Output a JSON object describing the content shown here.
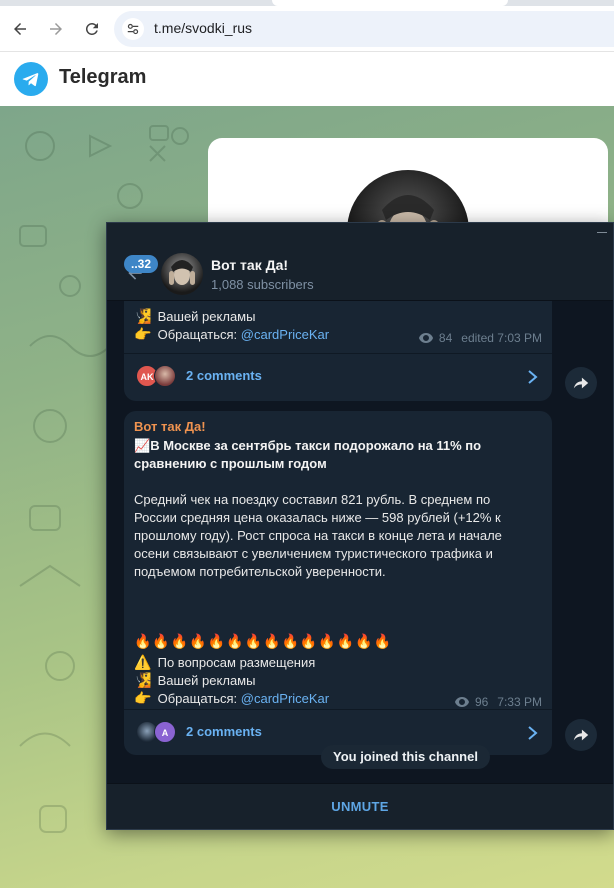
{
  "browser": {
    "url": "t.me/svodki_rus"
  },
  "telegram_header": {
    "title": "Telegram"
  },
  "chat": {
    "name": "Вот так Да!",
    "subscribers": "1,088 subscribers",
    "unread_count": "32"
  },
  "message1": {
    "lines": [
      {
        "emoji": "🧏",
        "text": "Вашей рекламы"
      },
      {
        "emoji": "👉",
        "prefix": "Обращаться: ",
        "link": "@cardPriceKar"
      }
    ],
    "views": "84",
    "time": "edited 7:03 PM",
    "comments_label": "2 comments",
    "commenter_initials": "AK"
  },
  "message2": {
    "author": "Вот так Да!",
    "title_emoji": "📈",
    "title_lines": [
      "В Москве за сентябрь такси подорожало на 11% по",
      "сравнению с прошлым годом"
    ],
    "body_lines": [
      "Средний чек на поездку составил 821 рубль. В среднем по",
      "России средняя цена оказалась ниже — 598 рублей (+12% к",
      "прошлому году). Рост спроса на такси в конце лета и начале",
      "осени связывают с увеличением туристического трафика и",
      "подъемом потребительской уверенности."
    ],
    "fires": "🔥🔥🔥🔥🔥🔥🔥🔥🔥🔥🔥🔥🔥🔥",
    "footer_lines": [
      {
        "emoji": "⚠️",
        "text": "По вопросам размещения"
      },
      {
        "emoji": "🧏",
        "text": "Вашей рекламы"
      },
      {
        "emoji": "👉",
        "prefix": "Обращаться: ",
        "link": "@cardPriceKar"
      }
    ],
    "views": "96",
    "time": "7:33 PM",
    "comments_label": "2 comments",
    "commenter_initial": "A"
  },
  "service_message": "You joined this channel",
  "bottom_action": "UNMUTE",
  "colors": {
    "accent": "#6ab2f2",
    "author": "#ef9350",
    "panel": "#17212b",
    "bubble": "#182533",
    "telegram_blue": "#2aabee"
  }
}
